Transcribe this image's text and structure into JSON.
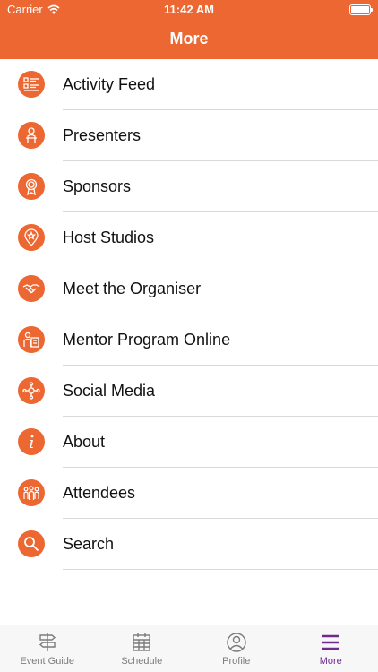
{
  "status_bar": {
    "carrier": "Carrier",
    "time": "11:42 AM"
  },
  "header": {
    "title": "More",
    "color": "#ec6731"
  },
  "menu": {
    "items": [
      {
        "label": "Activity Feed",
        "icon": "activity-feed-icon"
      },
      {
        "label": "Presenters",
        "icon": "presenter-icon"
      },
      {
        "label": "Sponsors",
        "icon": "award-ribbon-icon"
      },
      {
        "label": "Host Studios",
        "icon": "location-star-icon"
      },
      {
        "label": "Meet the Organiser",
        "icon": "handshake-icon"
      },
      {
        "label": "Mentor Program Online",
        "icon": "mentor-icon"
      },
      {
        "label": "Social Media",
        "icon": "network-icon"
      },
      {
        "label": "About",
        "icon": "info-icon"
      },
      {
        "label": "Attendees",
        "icon": "people-group-icon"
      },
      {
        "label": "Search",
        "icon": "search-icon"
      }
    ]
  },
  "tabbar": {
    "tabs": [
      {
        "label": "Event Guide",
        "icon": "signpost-icon",
        "active": false
      },
      {
        "label": "Schedule",
        "icon": "calendar-icon",
        "active": false
      },
      {
        "label": "Profile",
        "icon": "profile-icon",
        "active": false
      },
      {
        "label": "More",
        "icon": "menu-icon",
        "active": true
      }
    ],
    "active_color": "#6e2b8f",
    "inactive_color": "#7c7c7c"
  }
}
